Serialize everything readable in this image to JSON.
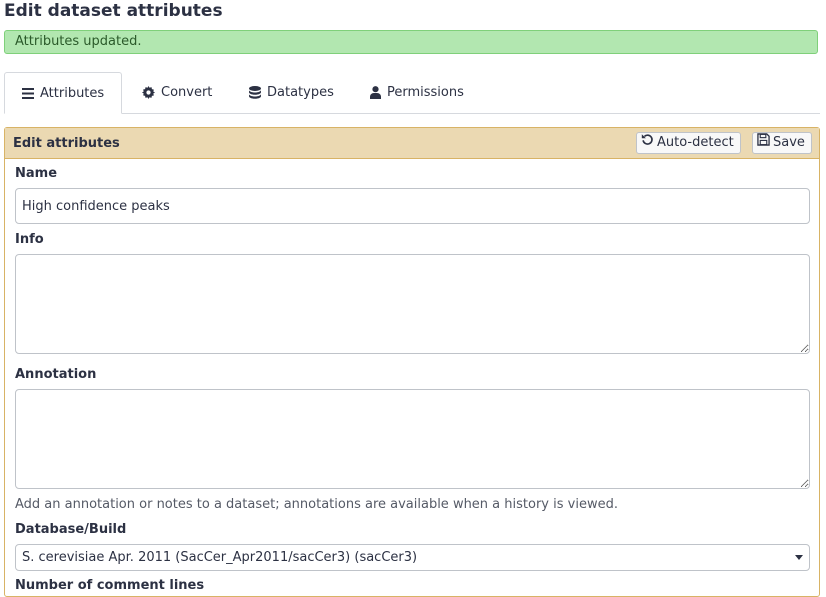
{
  "page": {
    "title": "Edit dataset attributes"
  },
  "alert": {
    "message": "Attributes updated."
  },
  "tabs": [
    {
      "label": "Attributes",
      "icon": "bars-icon",
      "active": true
    },
    {
      "label": "Convert",
      "icon": "gear-icon",
      "active": false
    },
    {
      "label": "Datatypes",
      "icon": "database-icon",
      "active": false
    },
    {
      "label": "Permissions",
      "icon": "user-icon",
      "active": false
    }
  ],
  "panel": {
    "title": "Edit attributes",
    "autodetect_label": "Auto-detect",
    "save_label": "Save"
  },
  "form": {
    "name_label": "Name",
    "name_value": "High confidence peaks",
    "info_label": "Info",
    "info_value": "",
    "annotation_label": "Annotation",
    "annotation_value": "",
    "annotation_help": "Add an annotation or notes to a dataset; annotations are available when a history is viewed.",
    "dbkey_label": "Database/Build",
    "dbkey_value": "S. cerevisiae Apr. 2011 (SacCer_Apr2011/sacCer3) (sacCer3)",
    "comment_lines_label": "Number of comment lines"
  },
  "colors": {
    "alert_bg": "#b2e7b0",
    "panel_header_bg": "#ebd9b2",
    "panel_border": "#d8b365"
  }
}
